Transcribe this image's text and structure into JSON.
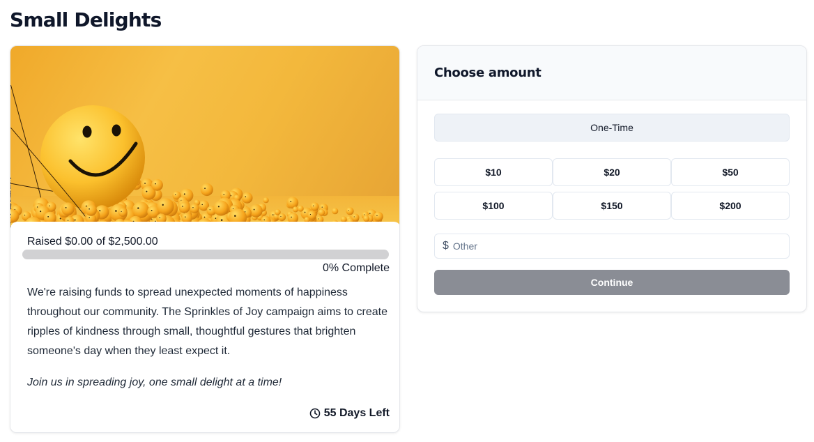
{
  "page": {
    "title": "Small Delights"
  },
  "campaign": {
    "raised_text": "Raised $0.00 of $2,500.00",
    "progress_fraction": 0,
    "complete_text": "0% Complete",
    "description": "We're raising funds to spread unexpected moments of happiness throughout our community. The Sprinkles of Joy campaign aims to create ripples of kindness through small, thoughtful gestures that brighten someone's day when they least expect it.",
    "tagline": "Join us in spreading joy, one small delight at a time!",
    "days_left": "55 Days Left",
    "image_icon": "smiley-face-balls-image",
    "clock_icon": "clock-icon"
  },
  "donation": {
    "header": "Choose amount",
    "frequency_label": "One-Time",
    "amounts": [
      "$10",
      "$20",
      "$50",
      "$100",
      "$150",
      "$200"
    ],
    "currency_symbol": "$",
    "other_placeholder": "Other",
    "continue_label": "Continue"
  },
  "colors": {
    "accent_yellow": "#f6bf45",
    "continue_disabled": "#8a8d95",
    "progress_track": "#d1d1d3"
  }
}
